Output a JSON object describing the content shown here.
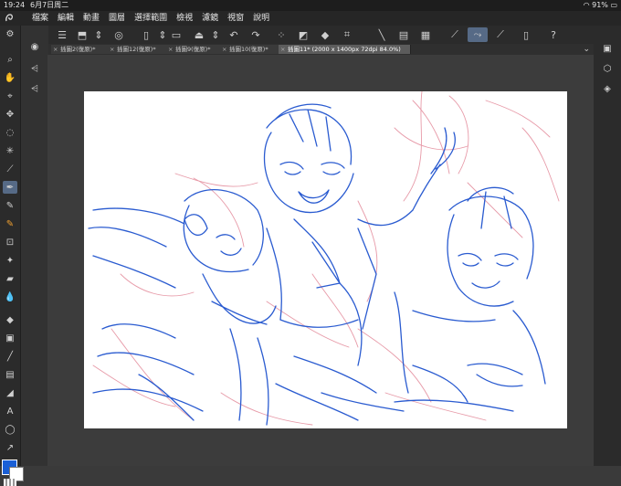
{
  "status_bar": {
    "time": "19:24",
    "date": "6月7日周二",
    "battery": "91%"
  },
  "menu": {
    "items": [
      "檔案",
      "編輯",
      "動畫",
      "圖層",
      "選擇範圍",
      "檢視",
      "濾鏡",
      "視窗",
      "說明"
    ]
  },
  "tabs": [
    {
      "label": "插圖2(復原)*"
    },
    {
      "label": "插圖12(復原)*"
    },
    {
      "label": "插圖9(復原)*"
    },
    {
      "label": "插圖10(復原)*"
    },
    {
      "label": "插圖11* (2000 x 1400px 72dpi 84.0%)",
      "active": true
    }
  ],
  "colors": {
    "main": "#1a5fd6",
    "sub": "#ffffff",
    "sketch_blue": "#2a5bd0",
    "sketch_pink": "#e79aa8"
  }
}
